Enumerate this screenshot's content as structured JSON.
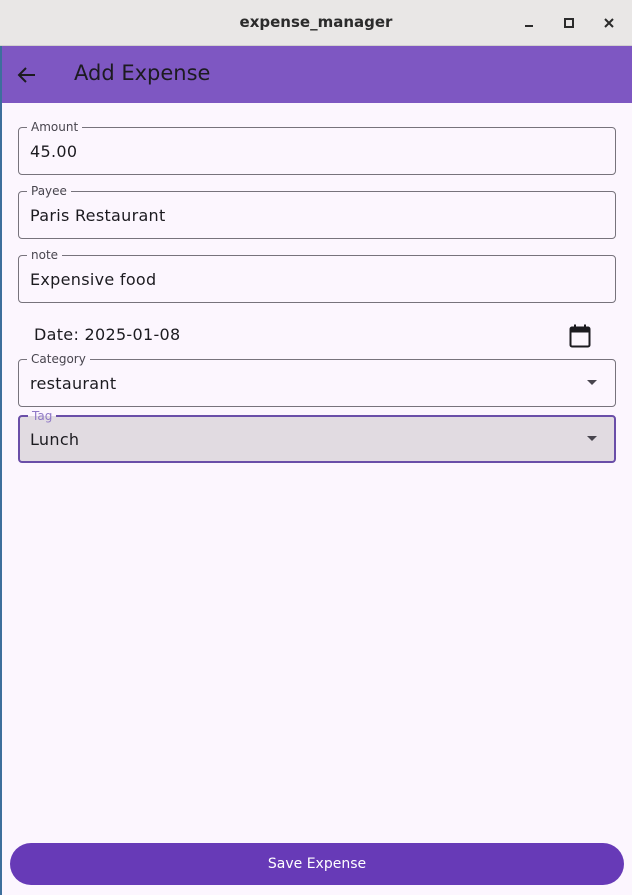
{
  "window": {
    "title": "expense_manager",
    "minimize_icon": "minimize-icon",
    "maximize_icon": "maximize-icon",
    "close_icon": "close-icon"
  },
  "appbar": {
    "back_icon": "arrow-back-icon",
    "title": "Add Expense",
    "color": "#7e57c2"
  },
  "form": {
    "amount": {
      "label": "Amount",
      "value": "45.00"
    },
    "payee": {
      "label": "Payee",
      "value": "Paris Restaurant"
    },
    "note": {
      "label": "note",
      "value": "Expensive food"
    },
    "date": {
      "text": "Date: 2025-01-08",
      "icon": "calendar-icon"
    },
    "category": {
      "label": "Category",
      "value": "restaurant"
    },
    "tag": {
      "label": "Tag",
      "value": "Lunch",
      "focused": true
    }
  },
  "save_button": {
    "label": "Save Expense",
    "color": "#673ab7"
  }
}
